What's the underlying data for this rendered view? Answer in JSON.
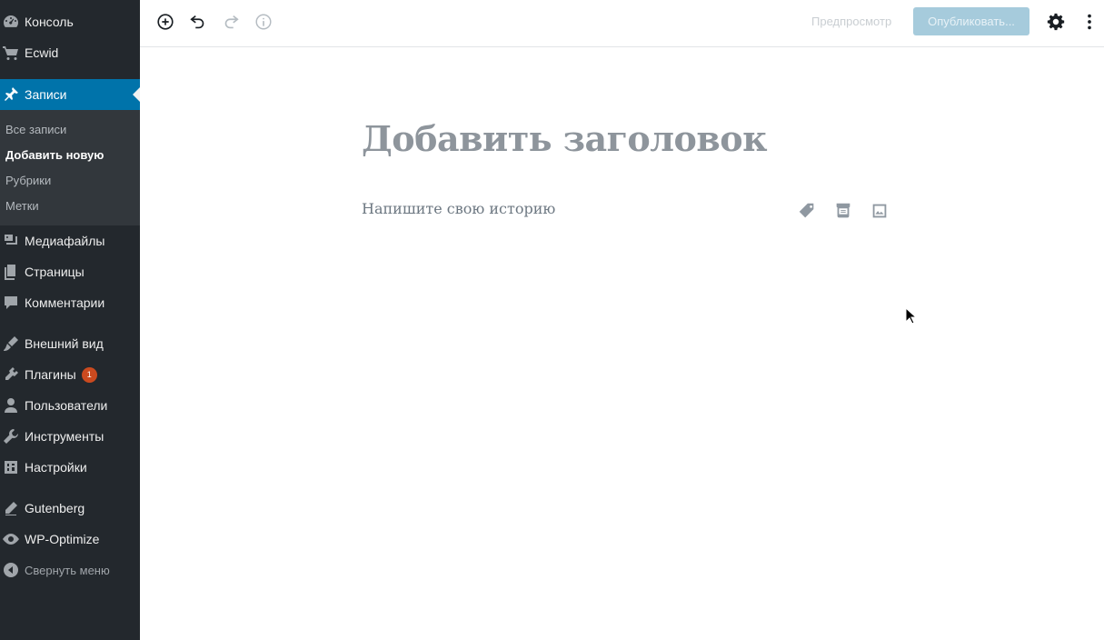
{
  "sidebar": {
    "items": [
      {
        "label": "Консоль",
        "icon": "dashboard-icon"
      },
      {
        "label": "Ecwid",
        "icon": "cart-icon"
      },
      {
        "label": "Записи",
        "icon": "pin-icon",
        "active": true
      },
      {
        "label": "Медиафайлы",
        "icon": "media-icon"
      },
      {
        "label": "Страницы",
        "icon": "pages-icon"
      },
      {
        "label": "Комментарии",
        "icon": "comment-icon"
      },
      {
        "label": "Внешний вид",
        "icon": "brush-icon"
      },
      {
        "label": "Плагины",
        "icon": "plugin-icon",
        "badge": "1"
      },
      {
        "label": "Пользователи",
        "icon": "user-icon"
      },
      {
        "label": "Инструменты",
        "icon": "wrench-icon"
      },
      {
        "label": "Настройки",
        "icon": "settings-icon"
      },
      {
        "label": "Gutenberg",
        "icon": "pencil-icon"
      },
      {
        "label": "WP-Optimize",
        "icon": "eye-icon"
      },
      {
        "label": "Свернуть меню",
        "icon": "collapse-icon"
      }
    ],
    "submenu": [
      "Все записи",
      "Добавить новую",
      "Рубрики",
      "Метки"
    ]
  },
  "toolbar": {
    "preview_label": "Предпросмотр",
    "publish_label": "Опубликовать..."
  },
  "editor": {
    "title_placeholder": "Добавить заголовок",
    "body_placeholder": "Напишите свою историю"
  },
  "colors": {
    "sidebar_bg": "#23282d",
    "active": "#0073aa",
    "badge": "#ca4a1f",
    "publish_disabled": "#a6cbdc"
  }
}
